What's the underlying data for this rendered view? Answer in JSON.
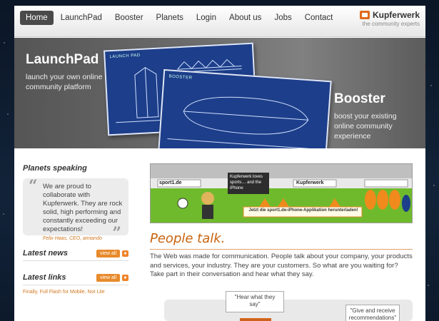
{
  "nav": {
    "items": [
      "Home",
      "LaunchPad",
      "Booster",
      "Planets",
      "Login",
      "About us",
      "Jobs",
      "Contact"
    ],
    "active": "Home"
  },
  "logo": {
    "name": "Kupferwerk",
    "tagline": "the community experts"
  },
  "hero": {
    "launchpad_title": "LaunchPad",
    "launchpad_sub": "launch your own online community platform",
    "booster_title": "Booster",
    "booster_sub": "boost your existing online community experience",
    "launchpad_plan_label": "LAUNCH PAD",
    "booster_plan_label": "BOOSTER"
  },
  "sidebar": {
    "planets_heading": "Planets speaking",
    "quote_text": "We are proud to collaborate with Kupferwerk. They are rock solid, high performing and constantly exceeding our expectations!",
    "quote_author": "Felix Haas, CEO, amiando",
    "news_heading": "Latest news",
    "links_heading": "Latest links",
    "view_all": "view all",
    "links_text": "Finally, Full Flash for Mobile, Not Lite"
  },
  "banner": {
    "ad1": "sport1.de",
    "ad2": "Kupferwerk",
    "speech": "Kupferwerk loves sports… and the iPhone",
    "caption": "Jetzt die sport1.de-iPhone-Applikation herunterladen!"
  },
  "main": {
    "heading": "People talk.",
    "body": "The Web was made for communication. People talk about your company, your products and services, your industry. They are your customers. So what are you waiting for? Take part in their conversation and hear what they say.",
    "bubble1": "\"Hear what they say\"",
    "bubble2": "\"Give and receive recommendations\""
  },
  "colors": {
    "accent": "#d0781f",
    "nav_active": "#4a4a4a",
    "hero_bg": "#6a6a6a",
    "banner_green": "#6fba2c"
  }
}
